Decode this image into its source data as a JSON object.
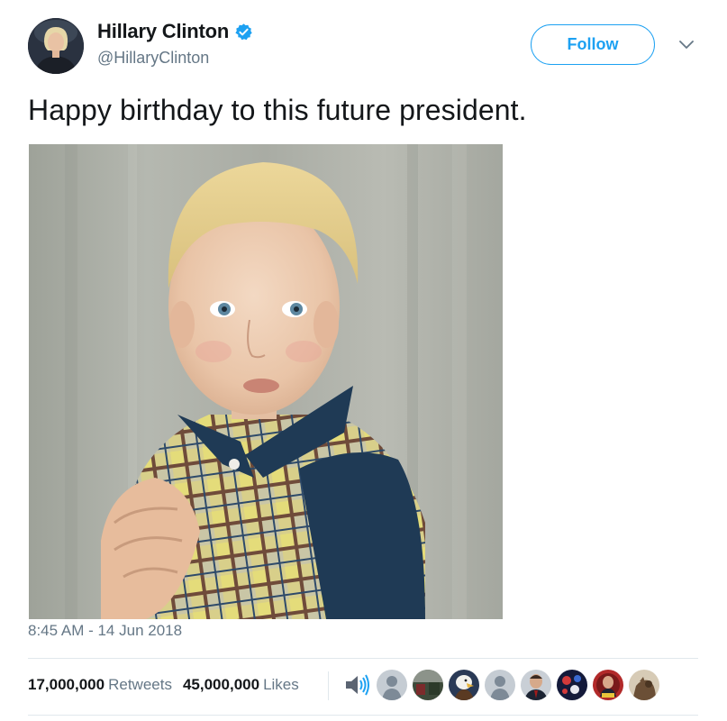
{
  "author": {
    "name": "Hillary Clinton",
    "handle": "@HillaryClinton",
    "verified_icon": "verified-badge-icon"
  },
  "actions": {
    "follow_label": "Follow",
    "more_icon": "chevron-down-icon"
  },
  "tweet": {
    "text": "Happy birthday to this future president.",
    "timestamp": "8:45 AM - 14 Jun 2018"
  },
  "stats": {
    "retweets_count": "17,000,000",
    "retweets_label": "Retweets",
    "likes_count": "45,000,000",
    "likes_label": "Likes"
  },
  "likers": [
    {
      "icon": "speaker-avatar-icon"
    },
    {
      "icon": "default-avatar-icon"
    },
    {
      "icon": "photo-avatar-icon"
    },
    {
      "icon": "eagle-avatar-icon"
    },
    {
      "icon": "default-avatar-icon"
    },
    {
      "icon": "man-avatar-icon"
    },
    {
      "icon": "fireworks-avatar-icon"
    },
    {
      "icon": "badge-avatar-icon"
    },
    {
      "icon": "animal-avatar-icon"
    }
  ],
  "colors": {
    "accent": "#1da1f2",
    "text": "#14171a",
    "secondary_text": "#657786",
    "divider": "#e1e8ed"
  }
}
